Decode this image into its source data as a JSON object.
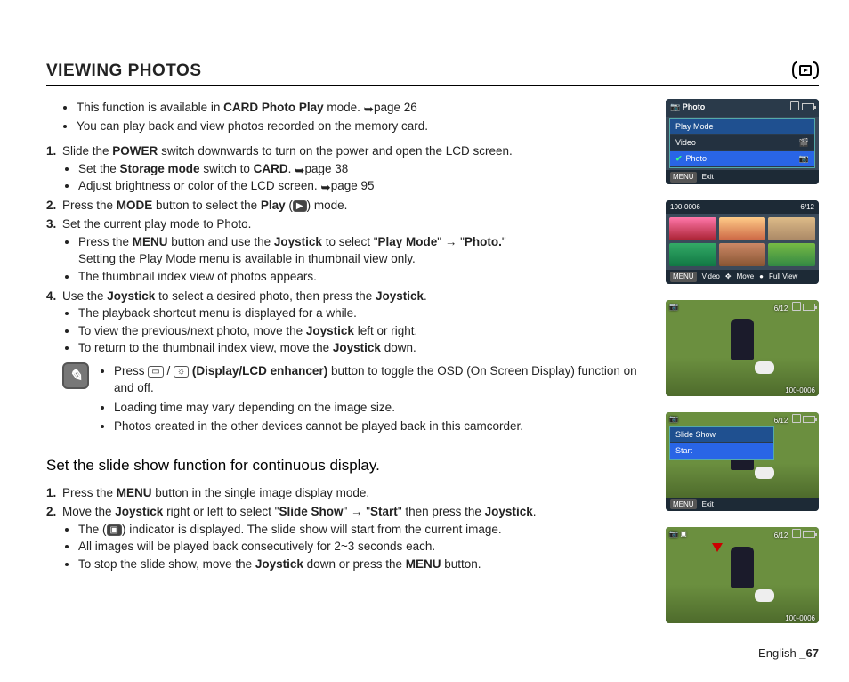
{
  "header": {
    "title": "VIEWING PHOTOS"
  },
  "intro": {
    "l1a": "This function is available in ",
    "l1b": "CARD Photo Play",
    "l1c": " mode. ",
    "l1d": "page 26",
    "l2": "You can play back and view photos recorded on the memory card."
  },
  "steps": [
    {
      "num": "1.",
      "pre": "Slide the ",
      "b1": "POWER",
      "post": " switch downwards to turn on the power and open the LCD screen.",
      "subs": [
        {
          "a": "Set the ",
          "b": "Storage mode",
          "c": " switch to ",
          "d": "CARD",
          "e": ". ",
          "f": "page 38"
        },
        {
          "a": "Adjust brightness or color of the LCD screen. ",
          "f": "page 95"
        }
      ]
    },
    {
      "num": "2.",
      "pre": "Press the ",
      "b1": "MODE",
      "post": " button to select the ",
      "b2": "Play",
      "post2": " (",
      "post3": ") mode."
    },
    {
      "num": "3.",
      "pre": "Set the current play mode to Photo.",
      "subs": [
        {
          "a": "Press the ",
          "b": "MENU",
          "c": " button and use the ",
          "d": "Joystick",
          "e": " to select \"",
          "f": "Play Mode",
          "g": "\" ",
          "h": "→",
          "i": " \"",
          "j": "Photo.",
          "k": "\"",
          "l": "Setting the Play Mode menu is available in thumbnail view only."
        },
        {
          "a": "The thumbnail index view of photos appears."
        }
      ]
    },
    {
      "num": "4.",
      "pre": "Use the ",
      "b1": "Joystick",
      "post": " to select a desired photo, then press the ",
      "b2": "Joystick",
      "post2": ".",
      "subs": [
        {
          "a": "The playback shortcut menu is displayed for a while."
        },
        {
          "a": "To view the previous/next photo, move the ",
          "b": "Joystick",
          "c": " left or right."
        },
        {
          "a": "To return to the thumbnail index view, move the ",
          "b": "Joystick",
          "c": " down."
        }
      ]
    }
  ],
  "note": {
    "l1a": "Press ",
    "l1b": " / ",
    "l1c": " (Display/LCD enhancer)",
    "l1d": " button to toggle the OSD (On Screen Display) function on and off.",
    "l2": "Loading time may vary depending on the image size.",
    "l3": "Photos created in the other devices cannot be played back in this camcorder."
  },
  "section2": {
    "title": "Set the slide show function for continuous display.",
    "s1": {
      "num": "1.",
      "a": "Press the ",
      "b": "MENU",
      "c": " button in the single image display mode."
    },
    "s2": {
      "num": "2.",
      "a": "Move the ",
      "b": "Joystick",
      "c": " right or left to select \"",
      "d": "Slide Show",
      "e": "\" ",
      "arr": "→",
      "f": " \"",
      "g": "Start",
      "h": "\" then press the ",
      "i": "Joystick",
      "j": "."
    },
    "subs": [
      {
        "a": "The (",
        "b": ") indicator is displayed. The slide show will start from the current image."
      },
      {
        "a": "All images will be played back consecutively for 2~3 seconds each."
      },
      {
        "a": "To stop the slide show, move the ",
        "b": "Joystick",
        "c": " down or press the ",
        "d": "MENU",
        "e": " button."
      }
    ]
  },
  "screens": {
    "s1": {
      "title": "Photo",
      "m1": "Play Mode",
      "m2": "Video",
      "m3": "Photo",
      "exit": "Exit",
      "menu": "MENU"
    },
    "s2": {
      "tl": "100-0006",
      "tr": "6/12",
      "f1": "Video",
      "f2": "Move",
      "f3": "Full View",
      "menu": "MENU"
    },
    "s3": {
      "tr": "6/12",
      "br": "100-0006"
    },
    "s4": {
      "tr": "6/12",
      "m1": "Slide Show",
      "m2": "Start",
      "exit": "Exit",
      "menu": "MENU"
    },
    "s5": {
      "tr": "6/12",
      "br": "100-0006"
    }
  },
  "footer": {
    "lang": "English ",
    "page": "_67"
  }
}
